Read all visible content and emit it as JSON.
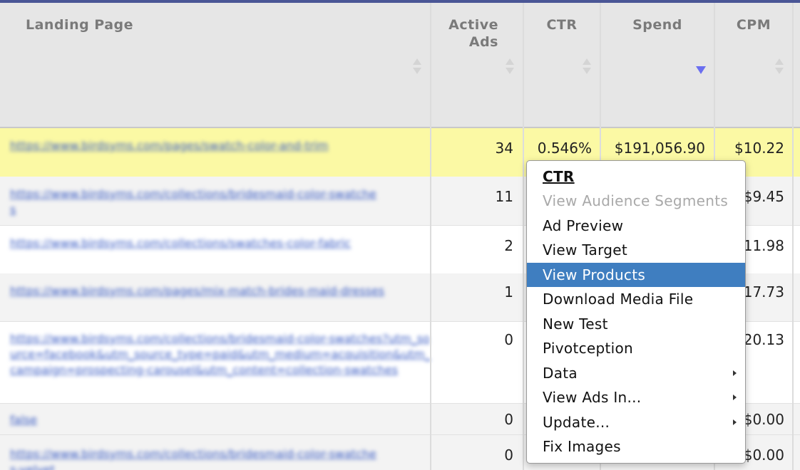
{
  "columns": {
    "landing_page": "Landing Page",
    "active_ads_line1": "Active",
    "active_ads_line2": "Ads",
    "ctr": "CTR",
    "spend": "Spend",
    "cpm": "CPM"
  },
  "rows": [
    {
      "url": "https://www.birdsyms.com/pages/swatch-color-and-trim",
      "active_ads": "34",
      "ctr": "0.546%",
      "spend": "$191,056.90",
      "cpm": "$10.22"
    },
    {
      "url": "https://www.birdsyms.com/collections/bridesmaid-color-swatches",
      "active_ads": "11",
      "ctr": "",
      "spend": "",
      "cpm": "$9.45"
    },
    {
      "url": "https://www.birdsyms.com/collections/swatches-color-fabric",
      "active_ads": "2",
      "ctr": "",
      "spend": "",
      "cpm": "11.98"
    },
    {
      "url": "https://www.birdsyms.com/pages/mix-match-brides-maid-dresses",
      "active_ads": "1",
      "ctr": "",
      "spend": "",
      "cpm": "17.73"
    },
    {
      "url": "https://www.birdsyms.com/collections/bridesmaid-color-swatches?utm_source=facebook&utm_source_type=paid&utm_medium=acquisition&utm_campaign=prospecting-carousel&utm_content=collection-swatches",
      "active_ads": "0",
      "ctr": "",
      "spend": "",
      "cpm": "20.13"
    },
    {
      "url": "false",
      "active_ads": "0",
      "ctr": "",
      "spend": "",
      "cpm": "$0.00"
    },
    {
      "url": "https://www.birdsyms.com/collections/bridesmaid-color-swatches-velvet",
      "active_ads": "0",
      "ctr": "",
      "spend": "",
      "cpm": "$0.00"
    }
  ],
  "context_menu": {
    "title": "CTR",
    "items": [
      {
        "label": "View Audience Segments"
      },
      {
        "label": "Ad Preview"
      },
      {
        "label": "View Target"
      },
      {
        "label": "View Products"
      },
      {
        "label": "Download Media File"
      },
      {
        "label": "New Test"
      },
      {
        "label": "Pivotception"
      },
      {
        "label": "Data"
      },
      {
        "label": "View Ads In..."
      },
      {
        "label": "Update..."
      },
      {
        "label": "Fix Images"
      }
    ]
  },
  "colors": {
    "highlight_row": "#fbf9a4",
    "menu_active": "#3f7ec0",
    "sort_active": "#6b6ff0"
  },
  "sort": {
    "column": "Spend",
    "direction": "descending"
  }
}
